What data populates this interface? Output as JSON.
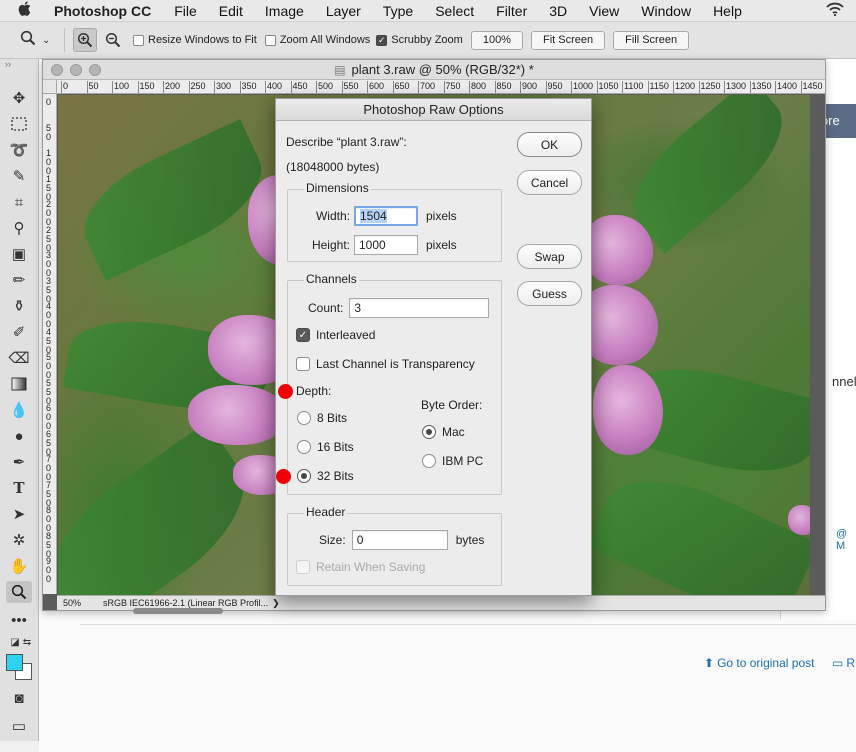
{
  "menubar": {
    "app_name": "Photoshop CC",
    "items": [
      "File",
      "Edit",
      "Image",
      "Layer",
      "Type",
      "Select",
      "Filter",
      "3D",
      "View",
      "Window",
      "Help"
    ]
  },
  "options_bar": {
    "resize_windows_label": "Resize Windows to Fit",
    "resize_windows_checked": false,
    "zoom_all_label": "Zoom All Windows",
    "zoom_all_checked": false,
    "scrubby_zoom_label": "Scrubby Zoom",
    "scrubby_zoom_checked": true,
    "zoom_percent_btn": "100%",
    "fit_screen_btn": "Fit Screen",
    "fill_screen_btn": "Fill Screen"
  },
  "document": {
    "title": "plant 3.raw @ 50% (RGB/32*) *",
    "ruler_top": [
      "0",
      "50",
      "100",
      "150",
      "200",
      "250",
      "300",
      "350",
      "400",
      "450",
      "500",
      "550",
      "600",
      "650",
      "700",
      "750",
      "800",
      "850",
      "900",
      "950",
      "1000",
      "1050",
      "1100",
      "1150",
      "1200",
      "1250",
      "1300",
      "1350",
      "1400",
      "1450"
    ],
    "ruler_left": [
      "0",
      "5\n0",
      "1\n0\n0",
      "1\n5\n0",
      "2\n0\n0",
      "2\n5\n0",
      "3\n0\n0",
      "3\n5\n0",
      "4\n0\n0",
      "4\n5\n0",
      "5\n0\n0",
      "5\n5\n0",
      "6\n0\n0",
      "6\n5\n0",
      "7\n0\n0",
      "7\n5\n0",
      "8\n0\n0",
      "8\n5\n0",
      "9\n0\n0",
      "9\n5\n0"
    ],
    "zoom": "50%",
    "profile": "sRGB IEC61966-2.1 (Linear RGB Profil..."
  },
  "dialog": {
    "title": "Photoshop Raw Options",
    "describe": "Describe “plant 3.raw”:",
    "bytes": "(18048000 bytes)",
    "dimensions": {
      "title": "Dimensions",
      "width_label": "Width:",
      "width_value": "1504",
      "height_label": "Height:",
      "height_value": "1000",
      "unit": "pixels"
    },
    "channels": {
      "title": "Channels",
      "count_label": "Count:",
      "count_value": "3",
      "interleaved_label": "Interleaved",
      "interleaved_checked": true,
      "last_channel_label": "Last Channel is Transparency",
      "last_channel_checked": false,
      "depth_label": "Depth:",
      "depth_options": [
        "8 Bits",
        "16 Bits",
        "32 Bits"
      ],
      "depth_selected": "32 Bits",
      "byte_order_label": "Byte Order:",
      "byte_order_options": [
        "Mac",
        "IBM PC"
      ],
      "byte_order_selected": "Mac"
    },
    "header": {
      "title": "Header",
      "size_label": "Size:",
      "size_value": "0",
      "unit": "bytes",
      "retain_label": "Retain When Saving",
      "retain_checked": false
    },
    "buttons": {
      "ok": "OK",
      "cancel": "Cancel",
      "swap": "Swap",
      "guess": "Guess"
    }
  },
  "background_page": {
    "explore_fragment": "lore",
    "side_fragment": "nnel",
    "m_fragment": "@ M",
    "go_to_original": "Go to original post",
    "r_fragment": "R"
  },
  "colors": {
    "foreground": "#2fd3f0",
    "background": "#ffffff",
    "annotation_dot": "#f00006"
  }
}
